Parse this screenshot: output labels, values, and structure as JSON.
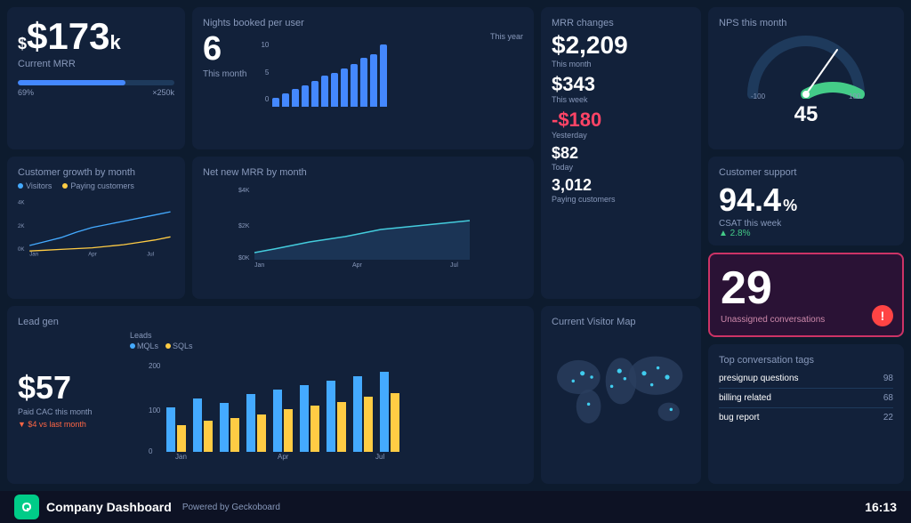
{
  "footer": {
    "title": "Company Dashboard",
    "powered": "Powered by Geckoboard",
    "time": "16:13",
    "logo": "G"
  },
  "cards": {
    "mrr": {
      "value": "$173",
      "unit": "k",
      "label": "Current MRR",
      "progress": 69,
      "progress_label_left": "69%",
      "progress_label_right": "×250k"
    },
    "nights": {
      "title": "Nights booked per user",
      "chart_title": "This year",
      "value": "6",
      "month_label": "This month",
      "y_labels": [
        "10",
        "5",
        "0"
      ],
      "bars": [
        2,
        3,
        4,
        5,
        6,
        7,
        7,
        8,
        8,
        9,
        9,
        10
      ]
    },
    "mrr_changes": {
      "title": "MRR changes",
      "items": [
        {
          "value": "$2,209",
          "label": "This month",
          "negative": false
        },
        {
          "value": "$343",
          "label": "This week",
          "negative": false
        },
        {
          "value": "-$180",
          "label": "Yesterday",
          "negative": true
        },
        {
          "value": "$82",
          "label": "Today",
          "negative": false
        },
        {
          "value": "3,012",
          "label": "Paying customers",
          "negative": false
        }
      ]
    },
    "nps": {
      "title": "NPS this month",
      "score": "45",
      "min": "-100",
      "max": "100"
    },
    "customer_growth": {
      "title": "Customer growth by month",
      "legend": [
        {
          "label": "Visitors",
          "color": "#44aaff"
        },
        {
          "label": "Paying customers",
          "color": "#ffcc44"
        }
      ],
      "y_labels": [
        "4K",
        "2K",
        "0K"
      ],
      "x_labels": [
        "Jan",
        "Apr",
        "Jul"
      ]
    },
    "net_mrr": {
      "title": "Net new MRR by month",
      "y_labels": [
        "$4K",
        "$2K",
        "$0K"
      ],
      "x_labels": [
        "Jan",
        "Apr",
        "Jul"
      ]
    },
    "customer_support": {
      "title": "Customer support",
      "csat_value": "94.4",
      "csat_unit": "%",
      "csat_label": "CSAT this week",
      "trend": "▲ 2.8%",
      "trend_color": "#44cc88"
    },
    "unassigned": {
      "number": "29",
      "label": "Unassigned conversations"
    },
    "tags": {
      "title": "Top conversation tags",
      "rows": [
        {
          "tag": "presignup questions",
          "count": "98"
        },
        {
          "tag": "billing related",
          "count": "68"
        },
        {
          "tag": "bug report",
          "count": "22"
        }
      ]
    },
    "lead_gen": {
      "title": "Lead gen",
      "value": "$57",
      "label": "Paid CAC this month",
      "trend": "▼ $4 vs last month",
      "chart_title": "Leads",
      "legend": [
        {
          "label": "MQLs",
          "color": "#44aaff"
        },
        {
          "label": "SQLs",
          "color": "#ffcc44"
        }
      ],
      "y_labels": [
        "200",
        "100",
        "0"
      ],
      "x_labels": [
        "Jan",
        "Apr",
        "Jul"
      ]
    },
    "visitor_map": {
      "title": "Current Visitor Map"
    }
  }
}
